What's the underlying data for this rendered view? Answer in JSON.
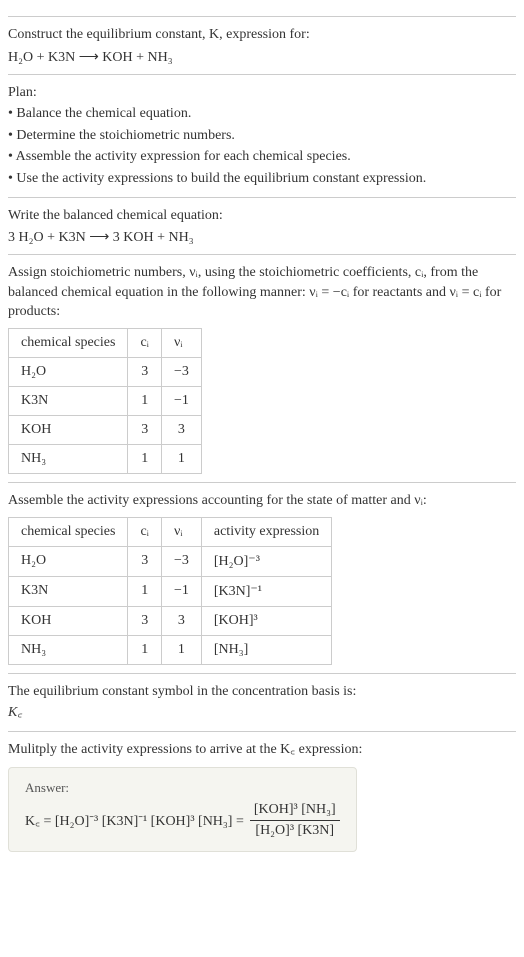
{
  "header": {
    "title": "Construct the equilibrium constant, K, expression for:",
    "equation": "H₂O + K3N ⟶ KOH + NH₃"
  },
  "plan": {
    "label": "Plan:",
    "items": [
      "• Balance the chemical equation.",
      "• Determine the stoichiometric numbers.",
      "• Assemble the activity expression for each chemical species.",
      "• Use the activity expressions to build the equilibrium constant expression."
    ]
  },
  "balanced": {
    "label": "Write the balanced chemical equation:",
    "equation": "3 H₂O + K3N ⟶ 3 KOH + NH₃"
  },
  "stoich": {
    "text": "Assign stoichiometric numbers, νᵢ, using the stoichiometric coefficients, cᵢ, from the balanced chemical equation in the following manner: νᵢ = −cᵢ for reactants and νᵢ = cᵢ for products:",
    "headers": [
      "chemical species",
      "cᵢ",
      "νᵢ"
    ],
    "rows": [
      {
        "species": "H₂O",
        "c": "3",
        "v": "−3"
      },
      {
        "species": "K3N",
        "c": "1",
        "v": "−1"
      },
      {
        "species": "KOH",
        "c": "3",
        "v": "3"
      },
      {
        "species": "NH₃",
        "c": "1",
        "v": "1"
      }
    ]
  },
  "activity": {
    "text": "Assemble the activity expressions accounting for the state of matter and νᵢ:",
    "headers": [
      "chemical species",
      "cᵢ",
      "νᵢ",
      "activity expression"
    ],
    "rows": [
      {
        "species": "H₂O",
        "c": "3",
        "v": "−3",
        "expr": "[H₂O]⁻³"
      },
      {
        "species": "K3N",
        "c": "1",
        "v": "−1",
        "expr": "[K3N]⁻¹"
      },
      {
        "species": "KOH",
        "c": "3",
        "v": "3",
        "expr": "[KOH]³"
      },
      {
        "species": "NH₃",
        "c": "1",
        "v": "1",
        "expr": "[NH₃]"
      }
    ]
  },
  "kc_symbol": {
    "text": "The equilibrium constant symbol in the concentration basis is:",
    "symbol": "K꜀"
  },
  "multiply": {
    "text": "Mulitply the activity expressions to arrive at the K꜀ expression:"
  },
  "answer": {
    "label": "Answer:",
    "lhs": "K꜀ = [H₂O]⁻³ [K3N]⁻¹ [KOH]³ [NH₃] =",
    "numerator": "[KOH]³ [NH₃]",
    "denominator": "[H₂O]³ [K3N]"
  }
}
